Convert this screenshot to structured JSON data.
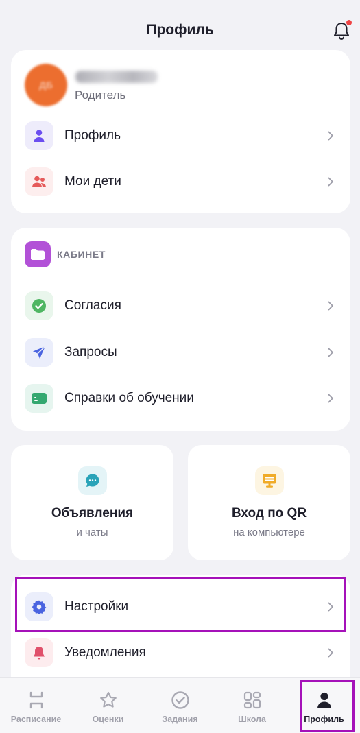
{
  "header": {
    "title": "Профиль"
  },
  "profile_card": {
    "user_name": "Дина Быкова",
    "avatar_initials": "ДБ",
    "role": "Родитель",
    "items": [
      {
        "label": "Профиль",
        "icon": "person-icon"
      },
      {
        "label": "Мои дети",
        "icon": "children-icon"
      }
    ]
  },
  "cabinet": {
    "title": "КАБИНЕТ",
    "items": [
      {
        "label": "Согласия",
        "icon": "check-circle-icon"
      },
      {
        "label": "Запросы",
        "icon": "send-icon"
      },
      {
        "label": "Справки об обучении",
        "icon": "certificate-icon"
      }
    ]
  },
  "tiles": [
    {
      "title": "Объявления",
      "subtitle": "и чаты",
      "icon": "chat-bubble-icon"
    },
    {
      "title": "Вход по QR",
      "subtitle": "на компьютере",
      "icon": "computer-icon"
    }
  ],
  "settings_card": {
    "items": [
      {
        "label": "Настройки",
        "icon": "gear-icon"
      },
      {
        "label": "Уведомления",
        "icon": "bell-icon"
      }
    ]
  },
  "tabbar": {
    "tabs": [
      {
        "label": "Расписание",
        "icon": "schedule-icon"
      },
      {
        "label": "Оценки",
        "icon": "star-icon"
      },
      {
        "label": "Задания",
        "icon": "check-circle-icon"
      },
      {
        "label": "Школа",
        "icon": "grid-icon"
      },
      {
        "label": "Профиль",
        "icon": "person-icon",
        "active": true
      }
    ]
  },
  "colors": {
    "accent_highlight": "#a511b9",
    "avatar": "#ec6e2f",
    "cabinet_icon": "#b251d7",
    "background": "#f2f2f6"
  }
}
